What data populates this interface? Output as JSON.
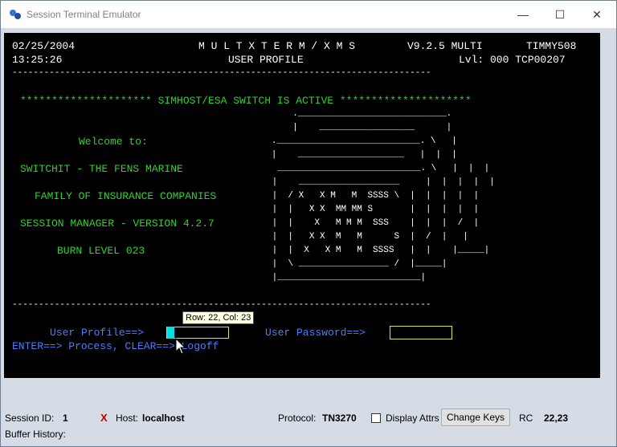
{
  "window": {
    "title": "Session Terminal Emulator",
    "minimize": "—",
    "maximize": "☐",
    "close": "✕"
  },
  "terminal": {
    "date": "02/25/2004",
    "time": "13:25:26",
    "product": "M U L T X T E R M / X M S",
    "version": "V9.2.5 MULTI",
    "user": "TIMMY508",
    "screen_title": "USER PROFILE",
    "level": "Lvl: 000 TCP00207",
    "divider": "-------------------------------------------------------------------------------",
    "banner_line": "********************* SIMHOST/ESA SWITCH IS ACTIVE *********************",
    "welcome": "Welcome to:",
    "company1": "SWITCHIT - THE FENS MARINE",
    "company2": "FAMILY OF INSURANCE COMPANIES",
    "session_mgr": "SESSION MANAGER - VERSION 4.2.7",
    "burn": "BURN LEVEL 023",
    "logo_lines": [
      "                                          .____________________________.",
      "                                          |    __________________      |",
      "                                      .___________________________. \\   |",
      "                                      |    ____________________   |  |  |",
      "                           ___________________________. \\   |  |  |",
      "                          |    ___________________     |  |  |  |  |",
      "                          |  / X   X M   M  SSSS \\  |  |  |  |  |",
      "                          |  |   X X  MM MM S       |  |  |  |  |",
      "                          |  |    X   M M M  SSS    |  |  |  /  |",
      "                          |  |   X X  M   M      S  |  /  |   |",
      "                          |  |  X   X M   M  SSSS   |  |    |_____|",
      "                          |  \\ _________________ /  |_____|",
      "                          |___________________________|"
    ],
    "profile_label": "User Profile==>",
    "password_label": "User Password==>",
    "enter_line": "ENTER==> Process, CLEAR==> Logoff",
    "tooltip": "Row: 22, Col: 23"
  },
  "status_bar": {
    "session_label": "Session ID:",
    "session_value": "1",
    "error_mark": "X",
    "host_label": "Host:",
    "host_value": "localhost",
    "protocol_label": "Protocol:",
    "protocol_value": "TN3270",
    "display_attrs_label": "Display Attrs",
    "display_attrs_checked": false,
    "change_keys_label": "Change Keys",
    "rc_label": "RC",
    "rc_value": "22,23",
    "buffer_history_label": "Buffer History:"
  },
  "colors": {
    "terminal_bg": "#000000",
    "terminal_green": "#2fd12f",
    "terminal_blue": "#4e7cff",
    "field_border": "#e2e23e",
    "cursor": "#00e0e0",
    "error_red": "#c00000"
  }
}
